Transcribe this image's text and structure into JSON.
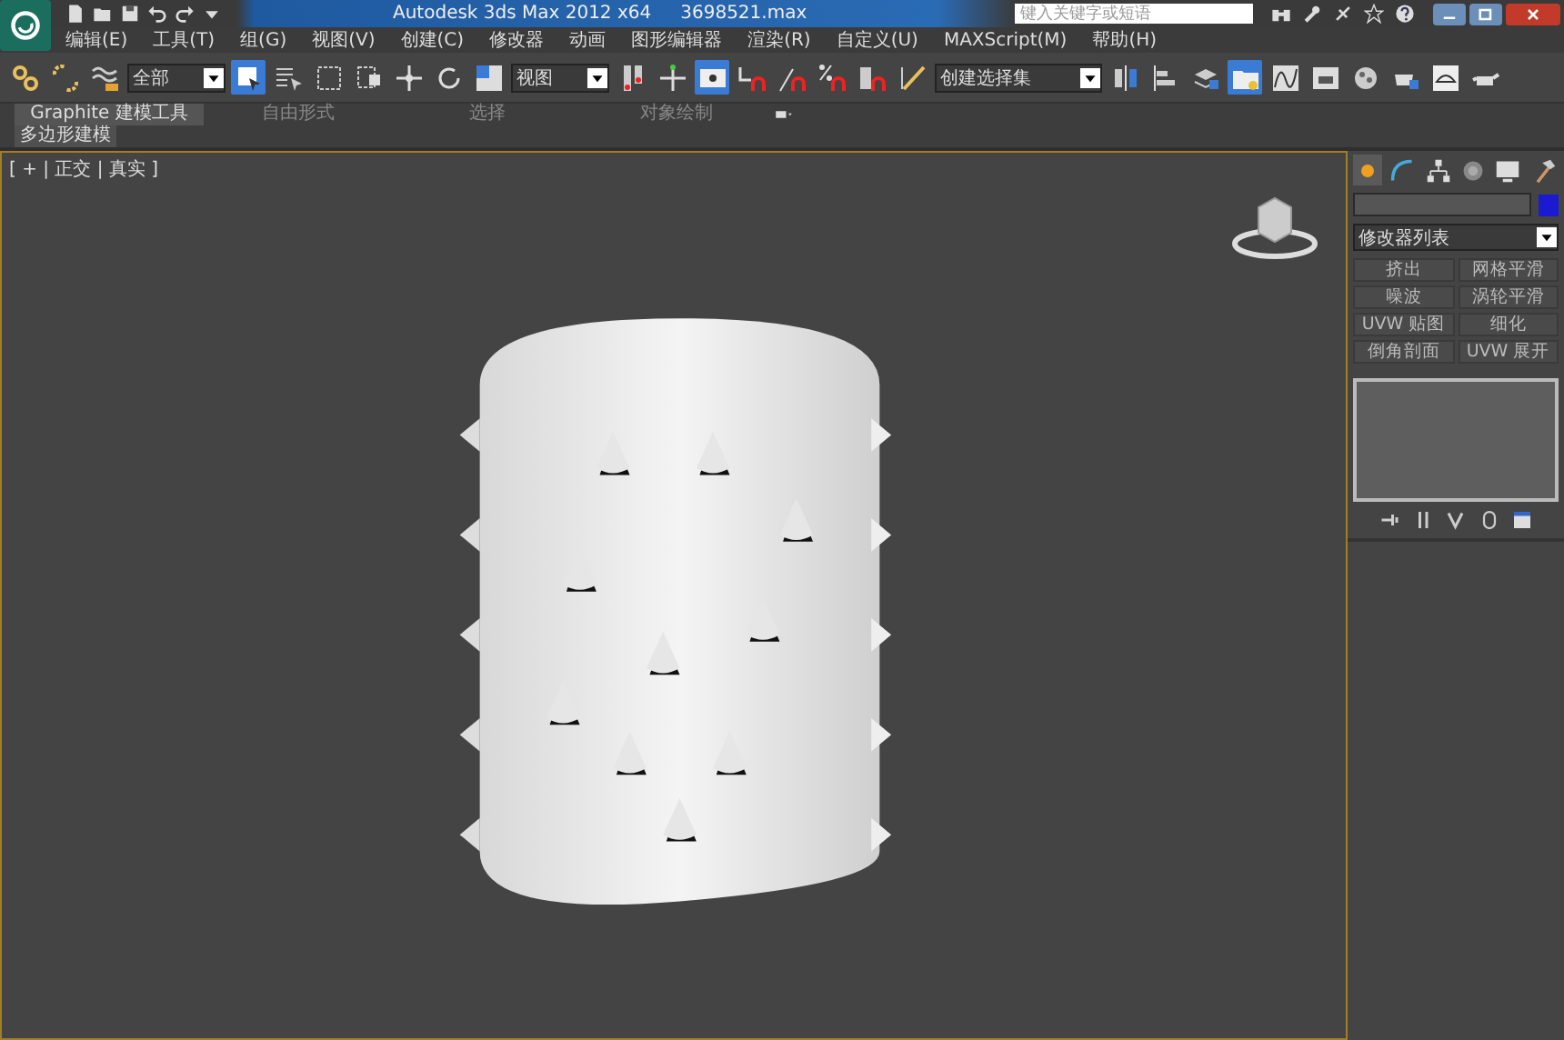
{
  "window": {
    "title": "Autodesk 3ds Max  2012 x64",
    "file": "3698521.max",
    "search": {
      "placeholder": "键入关键字或短语"
    }
  },
  "menu": [
    "编辑(E)",
    "工具(T)",
    "组(G)",
    "视图(V)",
    "创建(C)",
    "修改器",
    "动画",
    "图形编辑器",
    "渲染(R)",
    "自定义(U)",
    "MAXScript(M)",
    "帮助(H)"
  ],
  "main_toolbar": [
    {
      "kind": "icon",
      "selected": false
    },
    {
      "kind": "icon",
      "selected": false
    },
    {
      "kind": "icon",
      "selected": false
    },
    {
      "kind": "dropdown",
      "value": "全部"
    },
    {
      "kind": "icon",
      "selected": true
    },
    {
      "kind": "icon",
      "selected": false
    },
    {
      "kind": "icon",
      "selected": false
    },
    {
      "kind": "icon",
      "selected": false
    },
    {
      "kind": "icon",
      "selected": false
    },
    {
      "kind": "icon",
      "selected": false
    },
    {
      "kind": "icon",
      "selected": false
    },
    {
      "kind": "dropdown",
      "value": "视图"
    },
    {
      "kind": "icon",
      "selected": false
    },
    {
      "kind": "icon",
      "selected": false
    },
    {
      "kind": "icon",
      "selected": true
    },
    {
      "kind": "icon",
      "selected": false
    },
    {
      "kind": "icon",
      "selected": false
    },
    {
      "kind": "icon",
      "selected": false
    },
    {
      "kind": "icon",
      "selected": false
    },
    {
      "kind": "icon",
      "selected": false
    },
    {
      "kind": "dropdown",
      "value": "创建选择集"
    },
    {
      "kind": "icon",
      "selected": false
    },
    {
      "kind": "icon",
      "selected": false
    },
    {
      "kind": "icon",
      "selected": false
    },
    {
      "kind": "icon",
      "selected": true
    },
    {
      "kind": "icon",
      "selected": false
    },
    {
      "kind": "icon",
      "selected": false
    },
    {
      "kind": "icon",
      "selected": false
    },
    {
      "kind": "icon",
      "selected": false
    },
    {
      "kind": "icon",
      "selected": false
    },
    {
      "kind": "icon",
      "selected": false
    }
  ],
  "ribbon": {
    "tabs": [
      {
        "label": "Graphite 建模工具",
        "selected": true
      },
      {
        "label": "自由形式",
        "selected": false
      },
      {
        "label": "选择",
        "selected": false
      },
      {
        "label": "对象绘制",
        "selected": false
      }
    ],
    "panel": "多边形建模"
  },
  "viewport": {
    "label": "[ + | 正交 | 真实 ]"
  },
  "command_panel": {
    "tabs": [
      {
        "selected": true
      },
      {
        "selected": false
      },
      {
        "selected": false
      },
      {
        "selected": false
      },
      {
        "selected": false
      },
      {
        "selected": false
      }
    ],
    "modifier_list": "修改器列表",
    "modifiers": [
      "挤出",
      "网格平滑",
      "噪波",
      "涡轮平滑",
      "UVW 贴图",
      "细化",
      "倒角剖面",
      "UVW 展开"
    ]
  }
}
